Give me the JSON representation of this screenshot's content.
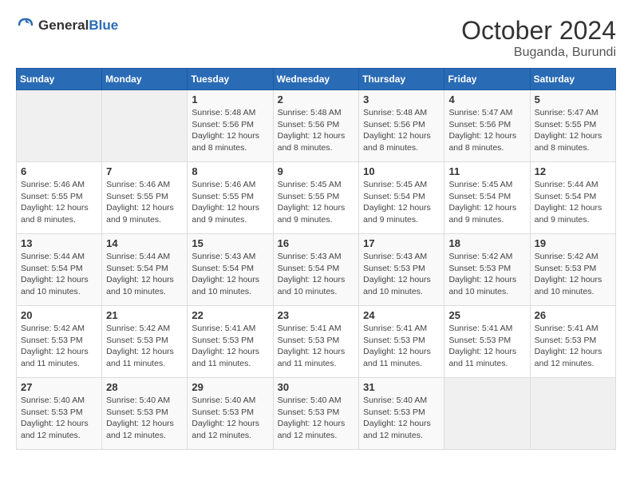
{
  "logo": {
    "text_general": "General",
    "text_blue": "Blue"
  },
  "title": {
    "month_year": "October 2024",
    "location": "Buganda, Burundi"
  },
  "calendar": {
    "headers": [
      "Sunday",
      "Monday",
      "Tuesday",
      "Wednesday",
      "Thursday",
      "Friday",
      "Saturday"
    ],
    "rows": [
      [
        {
          "day": "",
          "info": ""
        },
        {
          "day": "",
          "info": ""
        },
        {
          "day": "1",
          "info": "Sunrise: 5:48 AM\nSunset: 5:56 PM\nDaylight: 12 hours and 8 minutes."
        },
        {
          "day": "2",
          "info": "Sunrise: 5:48 AM\nSunset: 5:56 PM\nDaylight: 12 hours and 8 minutes."
        },
        {
          "day": "3",
          "info": "Sunrise: 5:48 AM\nSunset: 5:56 PM\nDaylight: 12 hours and 8 minutes."
        },
        {
          "day": "4",
          "info": "Sunrise: 5:47 AM\nSunset: 5:56 PM\nDaylight: 12 hours and 8 minutes."
        },
        {
          "day": "5",
          "info": "Sunrise: 5:47 AM\nSunset: 5:55 PM\nDaylight: 12 hours and 8 minutes."
        }
      ],
      [
        {
          "day": "6",
          "info": "Sunrise: 5:46 AM\nSunset: 5:55 PM\nDaylight: 12 hours and 8 minutes."
        },
        {
          "day": "7",
          "info": "Sunrise: 5:46 AM\nSunset: 5:55 PM\nDaylight: 12 hours and 9 minutes."
        },
        {
          "day": "8",
          "info": "Sunrise: 5:46 AM\nSunset: 5:55 PM\nDaylight: 12 hours and 9 minutes."
        },
        {
          "day": "9",
          "info": "Sunrise: 5:45 AM\nSunset: 5:55 PM\nDaylight: 12 hours and 9 minutes."
        },
        {
          "day": "10",
          "info": "Sunrise: 5:45 AM\nSunset: 5:54 PM\nDaylight: 12 hours and 9 minutes."
        },
        {
          "day": "11",
          "info": "Sunrise: 5:45 AM\nSunset: 5:54 PM\nDaylight: 12 hours and 9 minutes."
        },
        {
          "day": "12",
          "info": "Sunrise: 5:44 AM\nSunset: 5:54 PM\nDaylight: 12 hours and 9 minutes."
        }
      ],
      [
        {
          "day": "13",
          "info": "Sunrise: 5:44 AM\nSunset: 5:54 PM\nDaylight: 12 hours and 10 minutes."
        },
        {
          "day": "14",
          "info": "Sunrise: 5:44 AM\nSunset: 5:54 PM\nDaylight: 12 hours and 10 minutes."
        },
        {
          "day": "15",
          "info": "Sunrise: 5:43 AM\nSunset: 5:54 PM\nDaylight: 12 hours and 10 minutes."
        },
        {
          "day": "16",
          "info": "Sunrise: 5:43 AM\nSunset: 5:54 PM\nDaylight: 12 hours and 10 minutes."
        },
        {
          "day": "17",
          "info": "Sunrise: 5:43 AM\nSunset: 5:53 PM\nDaylight: 12 hours and 10 minutes."
        },
        {
          "day": "18",
          "info": "Sunrise: 5:42 AM\nSunset: 5:53 PM\nDaylight: 12 hours and 10 minutes."
        },
        {
          "day": "19",
          "info": "Sunrise: 5:42 AM\nSunset: 5:53 PM\nDaylight: 12 hours and 10 minutes."
        }
      ],
      [
        {
          "day": "20",
          "info": "Sunrise: 5:42 AM\nSunset: 5:53 PM\nDaylight: 12 hours and 11 minutes."
        },
        {
          "day": "21",
          "info": "Sunrise: 5:42 AM\nSunset: 5:53 PM\nDaylight: 12 hours and 11 minutes."
        },
        {
          "day": "22",
          "info": "Sunrise: 5:41 AM\nSunset: 5:53 PM\nDaylight: 12 hours and 11 minutes."
        },
        {
          "day": "23",
          "info": "Sunrise: 5:41 AM\nSunset: 5:53 PM\nDaylight: 12 hours and 11 minutes."
        },
        {
          "day": "24",
          "info": "Sunrise: 5:41 AM\nSunset: 5:53 PM\nDaylight: 12 hours and 11 minutes."
        },
        {
          "day": "25",
          "info": "Sunrise: 5:41 AM\nSunset: 5:53 PM\nDaylight: 12 hours and 11 minutes."
        },
        {
          "day": "26",
          "info": "Sunrise: 5:41 AM\nSunset: 5:53 PM\nDaylight: 12 hours and 12 minutes."
        }
      ],
      [
        {
          "day": "27",
          "info": "Sunrise: 5:40 AM\nSunset: 5:53 PM\nDaylight: 12 hours and 12 minutes."
        },
        {
          "day": "28",
          "info": "Sunrise: 5:40 AM\nSunset: 5:53 PM\nDaylight: 12 hours and 12 minutes."
        },
        {
          "day": "29",
          "info": "Sunrise: 5:40 AM\nSunset: 5:53 PM\nDaylight: 12 hours and 12 minutes."
        },
        {
          "day": "30",
          "info": "Sunrise: 5:40 AM\nSunset: 5:53 PM\nDaylight: 12 hours and 12 minutes."
        },
        {
          "day": "31",
          "info": "Sunrise: 5:40 AM\nSunset: 5:53 PM\nDaylight: 12 hours and 12 minutes."
        },
        {
          "day": "",
          "info": ""
        },
        {
          "day": "",
          "info": ""
        }
      ]
    ]
  }
}
